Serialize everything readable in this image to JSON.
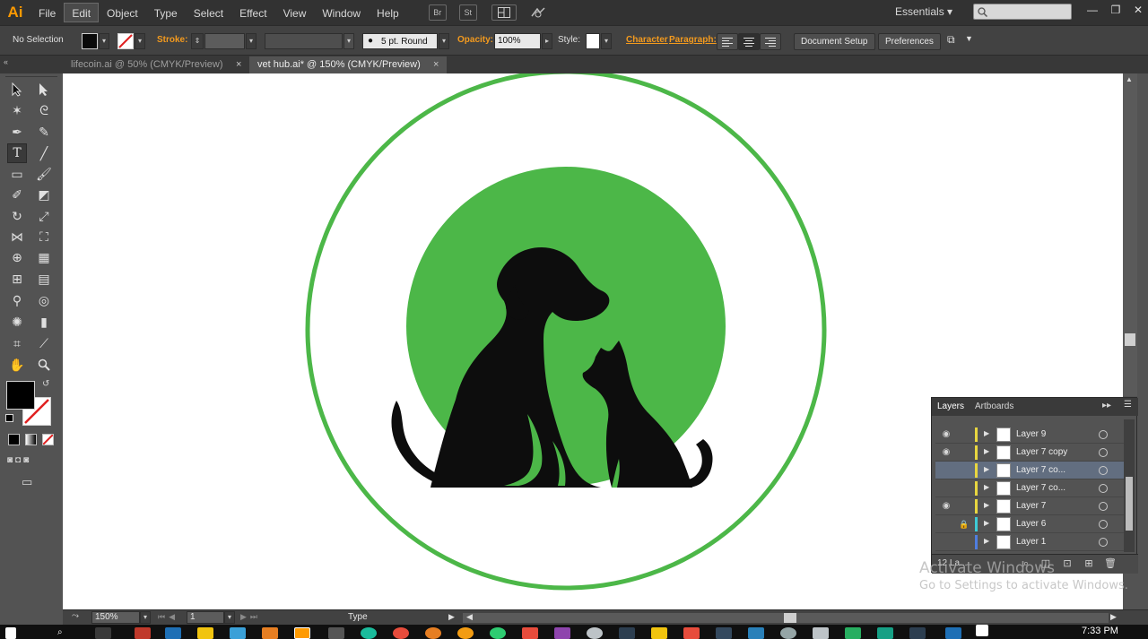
{
  "app": {
    "logo": "Ai"
  },
  "menu": {
    "items": [
      "File",
      "Edit",
      "Object",
      "Type",
      "Select",
      "Effect",
      "View",
      "Window",
      "Help"
    ],
    "active": "Edit",
    "bridge_label": "Br",
    "stock_label": "St"
  },
  "workspace": {
    "label": "Essentials"
  },
  "controlbar": {
    "selection": "No Selection",
    "stroke_label": "Stroke:",
    "brush": "5 pt. Round",
    "opacity_label": "Opacity:",
    "opacity_value": "100%",
    "style_label": "Style:",
    "character_link": "Character",
    "paragraph_link": "Paragraph:",
    "document_setup": "Document Setup",
    "preferences": "Preferences"
  },
  "tabs": [
    {
      "label": "lifecoin.ai @ 50% (CMYK/Preview)",
      "close": "×",
      "active": false
    },
    {
      "label": "vet hub.ai* @ 150% (CMYK/Preview)",
      "close": "×",
      "active": true
    }
  ],
  "artwork": {
    "ring_color": "#4cb748",
    "disc_color": "#4cb748",
    "silhouette_color": "#0d0d0d"
  },
  "layers_panel": {
    "tabs": [
      "Layers",
      "Artboards"
    ],
    "active_tab": "Layers",
    "rows": [
      {
        "name": "Layer 9",
        "visible": true,
        "locked": false,
        "color": "#e8d640",
        "selected": false
      },
      {
        "name": "Layer 7 copy",
        "visible": true,
        "locked": false,
        "color": "#e8d640",
        "selected": false
      },
      {
        "name": "Layer 7 co...",
        "visible": false,
        "locked": false,
        "color": "#e8d640",
        "selected": true
      },
      {
        "name": "Layer 7 co...",
        "visible": false,
        "locked": false,
        "color": "#e8d640",
        "selected": false
      },
      {
        "name": "Layer 7",
        "visible": true,
        "locked": false,
        "color": "#e8d640",
        "selected": false
      },
      {
        "name": "Layer 6",
        "visible": false,
        "locked": true,
        "color": "#3ecbd6",
        "selected": false
      },
      {
        "name": "Layer 1",
        "visible": false,
        "locked": false,
        "color": "#4f7ee0",
        "selected": false
      }
    ],
    "count": "12 La..."
  },
  "watermark": {
    "line1": "Activate Windows",
    "line2": "Go to Settings to activate Windows."
  },
  "statusbar": {
    "zoom": "150%",
    "page": "1",
    "status": "Type"
  },
  "taskbar": {
    "clock": "7:33 PM"
  }
}
